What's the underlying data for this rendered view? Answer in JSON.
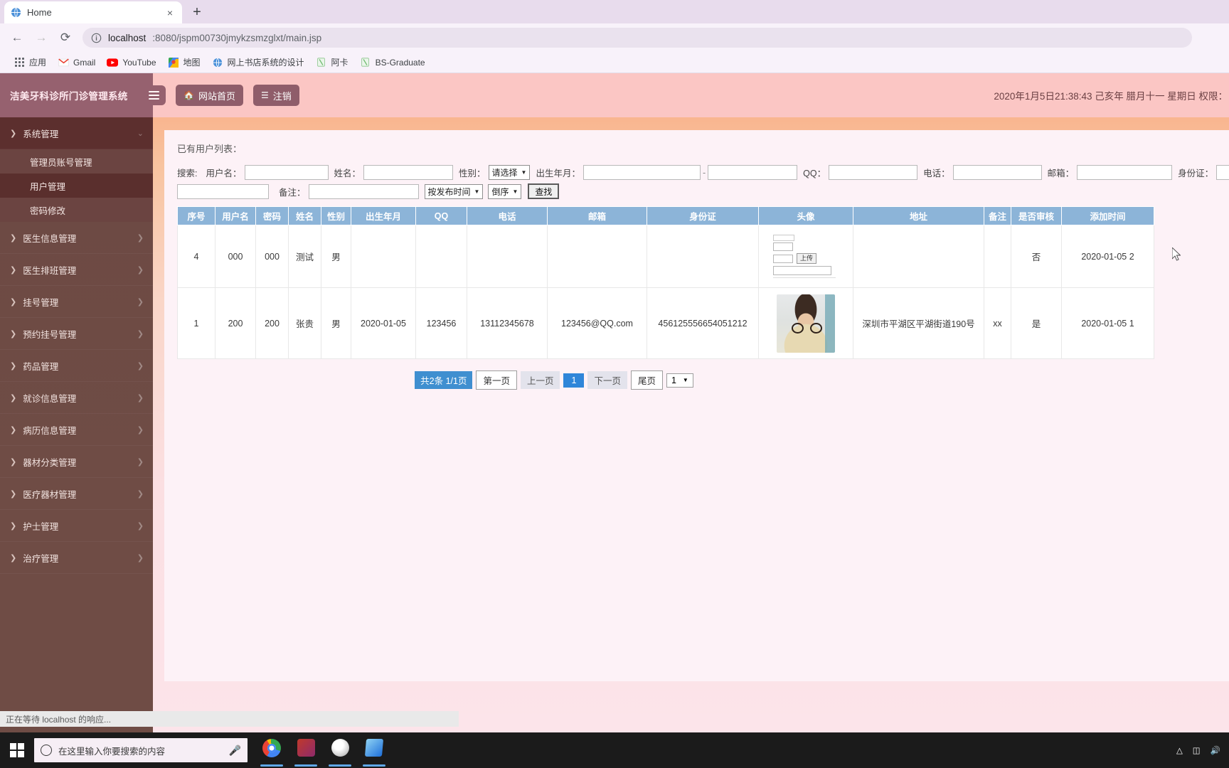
{
  "browser": {
    "tab": {
      "title": "Home",
      "favicon": "globe-icon",
      "close": "×"
    },
    "newtab_label": "+",
    "nav": {
      "back": "←",
      "forward": "→",
      "reload": "⟳"
    },
    "omnibox": {
      "host": "localhost",
      "rest": ":8080/jspm00730jmykzsmzglxt/main.jsp",
      "info_icon": "info-circle-icon"
    },
    "bookmarks": [
      {
        "label": "应用",
        "icon": "apps-grid-icon"
      },
      {
        "label": "Gmail",
        "icon": "gmail-icon"
      },
      {
        "label": "YouTube",
        "icon": "youtube-icon"
      },
      {
        "label": "地图",
        "icon": "maps-icon"
      },
      {
        "label": "网上书店系统的设计",
        "icon": "globe-icon"
      },
      {
        "label": "阿卡",
        "icon": "note-icon"
      },
      {
        "label": "BS-Graduate",
        "icon": "note-icon"
      }
    ],
    "status_text": "正在等待 localhost 的响应..."
  },
  "app": {
    "brand": "洁美牙科诊所门诊管理系统",
    "hamburger": "menu-icon",
    "topbuttons": [
      {
        "label": "网站首页",
        "icon": "home-icon"
      },
      {
        "label": "注销",
        "icon": "list-icon"
      }
    ],
    "datetime": "2020年1月5日21:38:43 己亥年 腊月十一 星期日  权限："
  },
  "sidebar": {
    "groups": [
      {
        "label": "系统管理",
        "open": true,
        "children": [
          {
            "label": "管理员账号管理",
            "active": false
          },
          {
            "label": "用户管理",
            "active": true
          },
          {
            "label": "密码修改",
            "active": false
          }
        ]
      },
      {
        "label": "医生信息管理",
        "open": false,
        "children": []
      },
      {
        "label": "医生排班管理",
        "open": false,
        "children": []
      },
      {
        "label": "挂号管理",
        "open": false,
        "children": []
      },
      {
        "label": "预约挂号管理",
        "open": false,
        "children": []
      },
      {
        "label": "药品管理",
        "open": false,
        "children": []
      },
      {
        "label": "就诊信息管理",
        "open": false,
        "children": []
      },
      {
        "label": "病历信息管理",
        "open": false,
        "children": []
      },
      {
        "label": "器材分类管理",
        "open": false,
        "children": []
      },
      {
        "label": "医疗器材管理",
        "open": false,
        "children": []
      },
      {
        "label": "护士管理",
        "open": false,
        "children": []
      },
      {
        "label": "治疗管理",
        "open": false,
        "children": []
      }
    ]
  },
  "main": {
    "list_title": "已有用户列表：",
    "search": {
      "prefix": "搜索:",
      "username_label": "用户名：",
      "username_value": "",
      "name_label": "姓名：",
      "name_value": "",
      "gender_label": "性别：",
      "gender_value": "请选择",
      "birth_label": "出生年月：",
      "birth_from": "",
      "birth_to": "",
      "qq_label": "QQ：",
      "qq_value": "",
      "phone_label": "电话：",
      "phone_value": "",
      "email_label": "邮箱：",
      "email_value": "",
      "idcard_label": "身份证：",
      "idcard_value": "",
      "addr_value": "",
      "remark_label": "备注：",
      "remark_value": "",
      "sort_field": "按发布时间",
      "sort_order": "倒序",
      "find_button": "查找"
    },
    "table": {
      "headers": [
        "序号",
        "用户名",
        "密码",
        "姓名",
        "性别",
        "出生年月",
        "QQ",
        "电话",
        "邮箱",
        "身份证",
        "头像",
        "地址",
        "备注",
        "是否审核",
        "添加时间"
      ],
      "rows": [
        {
          "seq": "4",
          "username": "000",
          "password": "000",
          "name": "测试",
          "gender": "男",
          "birth": "",
          "qq": "",
          "phone": "",
          "email": "",
          "idcard": "",
          "avatar": "upload-widget",
          "upload_button": "上传",
          "address": "",
          "remark": "",
          "audited": "否",
          "created": "2020-01-05 2"
        },
        {
          "seq": "1",
          "username": "200",
          "password": "200",
          "name": "张贵",
          "gender": "男",
          "birth": "2020-01-05",
          "qq": "123456",
          "phone": "13112345678",
          "email": "123456@QQ.com",
          "idcard": "456125556654051212",
          "avatar": "user-photo",
          "upload_button": "",
          "address": "深圳市平湖区平湖街道190号",
          "remark": "xx",
          "audited": "是",
          "created": "2020-01-05 1"
        }
      ]
    },
    "pager": {
      "summary": "共2条  1/1页",
      "first": "第一页",
      "prev": "上一页",
      "current": "1",
      "next": "下一页",
      "last": "尾页",
      "jump_value": "1"
    }
  },
  "taskbar": {
    "start_icon": "windows-logo-icon",
    "search_placeholder": "在这里输入你要搜索的内容",
    "mic_icon": "microphone-icon",
    "apps": [
      {
        "name": "chrome-taskbar-icon"
      },
      {
        "name": "red-app-taskbar-icon"
      },
      {
        "name": "gray-app-taskbar-icon"
      },
      {
        "name": "blue-app-taskbar-icon"
      }
    ]
  }
}
